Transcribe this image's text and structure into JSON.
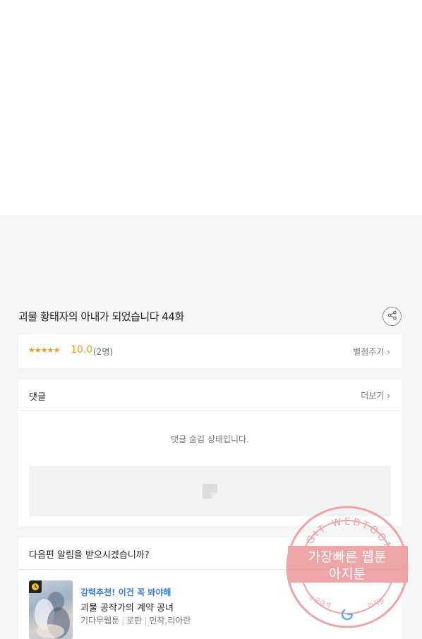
{
  "episode": {
    "title": "괴물 황태자의 아내가 되었습니다 44화"
  },
  "rating": {
    "stars": "★★★★★",
    "score": "10.0",
    "count": "(2명)",
    "rate_link": "별점주기 ›"
  },
  "comments": {
    "title": "댓글",
    "more_link": "더보기 ›",
    "hidden_message": "댓글 숨김 상태입니다."
  },
  "notify": {
    "title": "다음편 알림을 받으시겠습니까?"
  },
  "recommendation": {
    "label": "강력추천! 이건 꼭 봐야해",
    "title": "괴물 공작가의 계약 공녀",
    "platform": "기다무웹툰",
    "genre": "로판",
    "authors": "민작,리아란"
  },
  "watermark": {
    "arc_text": "AGIT WEBTOON",
    "line1": "가장빠른 웹툰",
    "line2": "아지툰",
    "bottom_left": "구글검색",
    "bottom_right": "아지툰",
    "color": "#e8888a"
  },
  "colors": {
    "accent_orange": "#f29a1e",
    "link_blue": "#3a7bd5",
    "background_gray": "#f5f5f5"
  },
  "icons": {
    "share": "share-icon",
    "clock": "clock-icon",
    "placeholder": "image-placeholder-icon"
  }
}
